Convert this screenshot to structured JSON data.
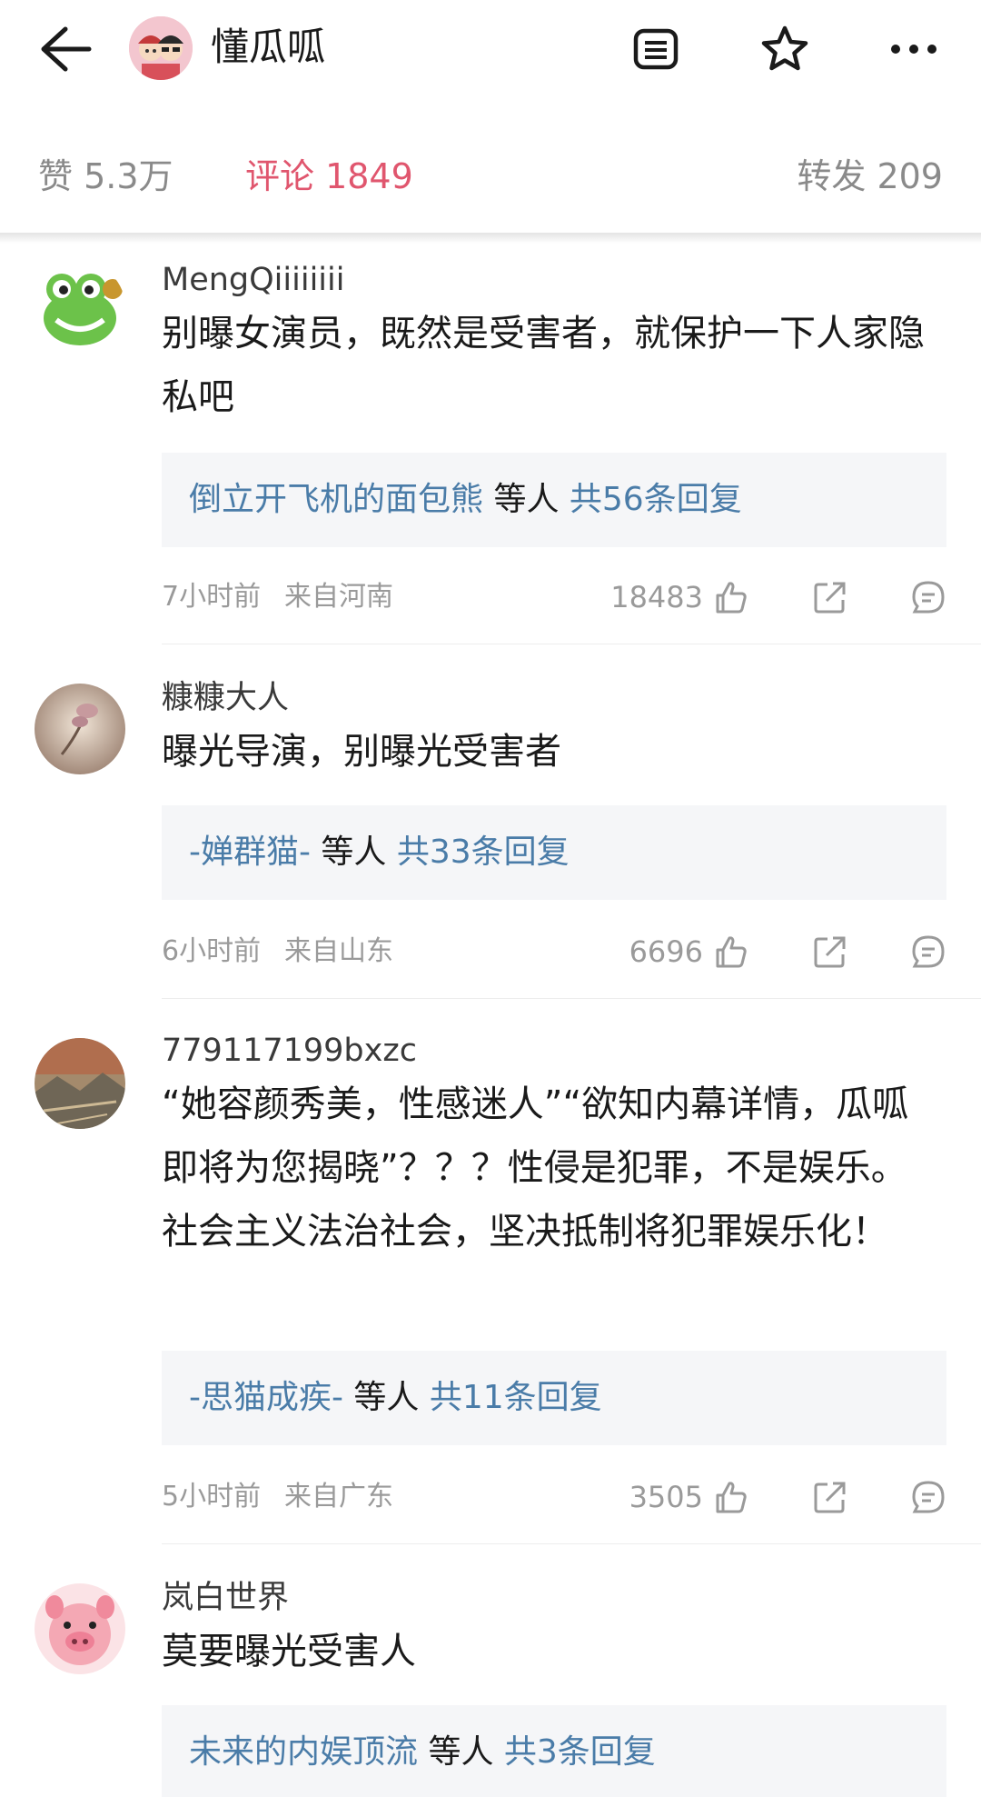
{
  "header": {
    "title": "懂瓜呱",
    "icons": [
      "back-arrow-icon",
      "list-icon",
      "star-icon",
      "more-icon"
    ]
  },
  "tabs": {
    "like": "赞 5.3万",
    "comment": "评论 1849",
    "repost": "转发 209"
  },
  "colors": {
    "accent": "#e0566e",
    "link": "#4a7ca8",
    "reply_bg": "#f5f6f8",
    "meta": "#9a9a9a"
  },
  "comments": [
    {
      "user": "MengQiiiiiiii",
      "text": "别曝女演员，既然是受害者，就保护一下人家隐私吧",
      "reply_names": "倒立开飞机的面包熊",
      "reply_mid": " 等人 ",
      "reply_count": "共56条回复",
      "time": "7小时前",
      "location": "来自河南",
      "likes": "18483"
    },
    {
      "user": "糠糠大人",
      "text": "曝光导演，别曝光受害者",
      "reply_names": "-婵群猫-",
      "reply_mid": " 等人 ",
      "reply_count": "共33条回复",
      "time": "6小时前",
      "location": "来自山东",
      "likes": "6696"
    },
    {
      "user": "779117199bxzc",
      "text": "“她容颜秀美，性感迷人”“欲知内幕详情，瓜呱即将为您揭晓”？？？性侵是犯罪，不是娱乐。社会主义法治社会，坚决抵制将犯罪娱乐化！",
      "reply_names": "-思猫成疾-",
      "reply_mid": " 等人 ",
      "reply_count": "共11条回复",
      "time": "5小时前",
      "location": "来自广东",
      "likes": "3505"
    },
    {
      "user": "岚白世界",
      "text": "莫要曝光受害人",
      "reply_names": "未来的内娱顶流",
      "reply_mid": " 等人 ",
      "reply_count": "共3条回复"
    }
  ]
}
